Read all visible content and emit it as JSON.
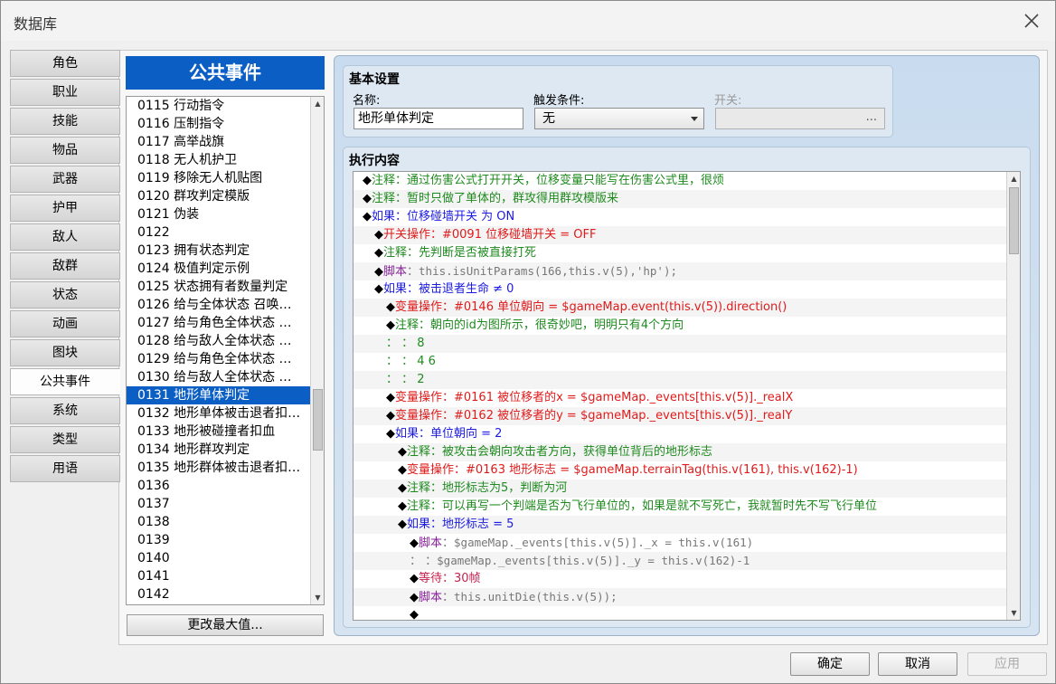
{
  "window": {
    "title": "数据库"
  },
  "tabs": [
    "角色",
    "职业",
    "技能",
    "物品",
    "武器",
    "护甲",
    "敌人",
    "敌群",
    "状态",
    "动画",
    "图块",
    "公共事件",
    "系统",
    "类型",
    "用语"
  ],
  "list": {
    "header": "公共事件",
    "items": [
      "0115 行动指令",
      "0116 压制指令",
      "0117 高举战旗",
      "0118 无人机护卫",
      "0119 移除无人机贴图",
      "0120 群攻判定模版",
      "0121 伪装",
      "0122",
      "0123 拥有状态判定",
      "0124 极值判定示例",
      "0125 状态拥有者数量判定",
      "0126 给与全体状态 召唤…",
      "0127 给与角色全体状态 …",
      "0128 给与敌人全体状态 …",
      "0129 给与角色全体状态 …",
      "0130 给与敌人全体状态 …",
      "0131 地形单体判定",
      "0132 地形单体被击退者扣…",
      "0133 地形被碰撞者扣血",
      "0134 地形群攻判定",
      "0135 地形群体被击退者扣…",
      "0136",
      "0137",
      "0138",
      "0139",
      "0140",
      "0141",
      "0142"
    ],
    "selected_index": 16,
    "change_max_button": "更改最大值..."
  },
  "settings": {
    "group_title": "基本设置",
    "name_label": "名称:",
    "name_value": "地形单体判定",
    "trigger_label": "触发条件:",
    "trigger_value": "无",
    "switch_label": "开关:",
    "switch_button": "..."
  },
  "contents": {
    "group_title": "执行内容",
    "lines": [
      {
        "indent": 0,
        "segments": [
          {
            "t": "◆",
            "c": "diamond"
          },
          {
            "t": "注释：通过伤害公式打开开关，位移变量只能写在伤害公式里，很烦",
            "c": "c-green"
          }
        ]
      },
      {
        "indent": 0,
        "segments": [
          {
            "t": "◆",
            "c": "diamond"
          },
          {
            "t": "注释：暂时只做了单体的，群攻得用群攻模版来",
            "c": "c-green"
          }
        ]
      },
      {
        "indent": 0,
        "segments": [
          {
            "t": "◆",
            "c": "diamond"
          },
          {
            "t": "如果：位移碰墙开关 为 ON",
            "c": "c-blue"
          }
        ]
      },
      {
        "indent": 1,
        "segments": [
          {
            "t": "◆",
            "c": "diamond"
          },
          {
            "t": "开关操作：#0091 位移碰墙开关 = OFF",
            "c": "c-red"
          }
        ]
      },
      {
        "indent": 1,
        "segments": [
          {
            "t": "◆",
            "c": "diamond"
          },
          {
            "t": "注释：先判断是否被直接打死",
            "c": "c-green"
          }
        ]
      },
      {
        "indent": 1,
        "segments": [
          {
            "t": "◆",
            "c": "diamond"
          },
          {
            "t": "脚本",
            "c": "c-purple"
          },
          {
            "t": "：",
            "c": "c-gray"
          },
          {
            "t": "this.isUnitParams(166,this.v(5),'hp');",
            "c": "c-gray mono"
          }
        ]
      },
      {
        "indent": 1,
        "segments": [
          {
            "t": "◆",
            "c": "diamond"
          },
          {
            "t": "如果：被击退者生命 ≠ 0",
            "c": "c-blue"
          }
        ]
      },
      {
        "indent": 2,
        "segments": [
          {
            "t": "◆",
            "c": "diamond"
          },
          {
            "t": "变量操作：#0146 单位朝向 = $gameMap.event(this.v(5)).direction()",
            "c": "c-red"
          }
        ]
      },
      {
        "indent": 2,
        "segments": [
          {
            "t": "◆",
            "c": "diamond"
          },
          {
            "t": "注释：朝向的id为图所示，很奇妙吧，明明只有4个方向",
            "c": "c-green"
          }
        ]
      },
      {
        "indent": 2,
        "segments": [
          {
            "t": "：      ：      8",
            "c": "c-green"
          }
        ]
      },
      {
        "indent": 2,
        "segments": [
          {
            "t": "：      ：    4   6",
            "c": "c-green"
          }
        ]
      },
      {
        "indent": 2,
        "segments": [
          {
            "t": "：      ：      2",
            "c": "c-green"
          }
        ]
      },
      {
        "indent": 2,
        "segments": [
          {
            "t": "◆",
            "c": "diamond"
          },
          {
            "t": "变量操作：#0161 被位移者的x = $gameMap._events[this.v(5)]._realX",
            "c": "c-red"
          }
        ]
      },
      {
        "indent": 2,
        "segments": [
          {
            "t": "◆",
            "c": "diamond"
          },
          {
            "t": "变量操作：#0162 被位移者的y = $gameMap._events[this.v(5)]._realY",
            "c": "c-red"
          }
        ]
      },
      {
        "indent": 2,
        "segments": [
          {
            "t": "◆",
            "c": "diamond"
          },
          {
            "t": "如果：单位朝向 = 2",
            "c": "c-blue"
          }
        ]
      },
      {
        "indent": 3,
        "segments": [
          {
            "t": "◆",
            "c": "diamond"
          },
          {
            "t": "注释：被攻击会朝向攻击者方向，获得单位背后的地形标志",
            "c": "c-green"
          }
        ]
      },
      {
        "indent": 3,
        "segments": [
          {
            "t": "◆",
            "c": "diamond"
          },
          {
            "t": "变量操作：#0163 地形标志 = $gameMap.terrainTag(this.v(161), this.v(162)-1)",
            "c": "c-red"
          }
        ]
      },
      {
        "indent": 3,
        "segments": [
          {
            "t": "◆",
            "c": "diamond"
          },
          {
            "t": "注释：地形标志为5，判断为河",
            "c": "c-green"
          }
        ]
      },
      {
        "indent": 3,
        "segments": [
          {
            "t": "◆",
            "c": "diamond"
          },
          {
            "t": "注释：可以再写一个判端是否为飞行单位的，如果是就不写死亡，我就暂时先不写飞行单位",
            "c": "c-green"
          }
        ]
      },
      {
        "indent": 3,
        "segments": [
          {
            "t": "◆",
            "c": "diamond"
          },
          {
            "t": "如果：地形标志 = 5",
            "c": "c-blue"
          }
        ]
      },
      {
        "indent": 4,
        "segments": [
          {
            "t": "◆",
            "c": "diamond"
          },
          {
            "t": "脚本",
            "c": "c-purple"
          },
          {
            "t": "：",
            "c": "c-gray"
          },
          {
            "t": "$gameMap._events[this.v(5)]._x = this.v(161)",
            "c": "c-gray mono"
          }
        ]
      },
      {
        "indent": 4,
        "segments": [
          {
            "t": "：     ：",
            "c": "c-gray"
          },
          {
            "t": "$gameMap._events[this.v(5)]._y = this.v(162)-1",
            "c": "c-gray mono"
          }
        ]
      },
      {
        "indent": 4,
        "segments": [
          {
            "t": "◆",
            "c": "diamond"
          },
          {
            "t": "等待：30帧",
            "c": "c-darkred"
          }
        ]
      },
      {
        "indent": 4,
        "segments": [
          {
            "t": "◆",
            "c": "diamond"
          },
          {
            "t": "脚本",
            "c": "c-purple"
          },
          {
            "t": "：",
            "c": "c-gray"
          },
          {
            "t": "this.unitDie(this.v(5));",
            "c": "c-gray mono"
          }
        ]
      },
      {
        "indent": 4,
        "segments": [
          {
            "t": "◆",
            "c": "diamond"
          }
        ]
      }
    ]
  },
  "footer": {
    "ok": "确定",
    "cancel": "取消",
    "apply": "应用"
  }
}
